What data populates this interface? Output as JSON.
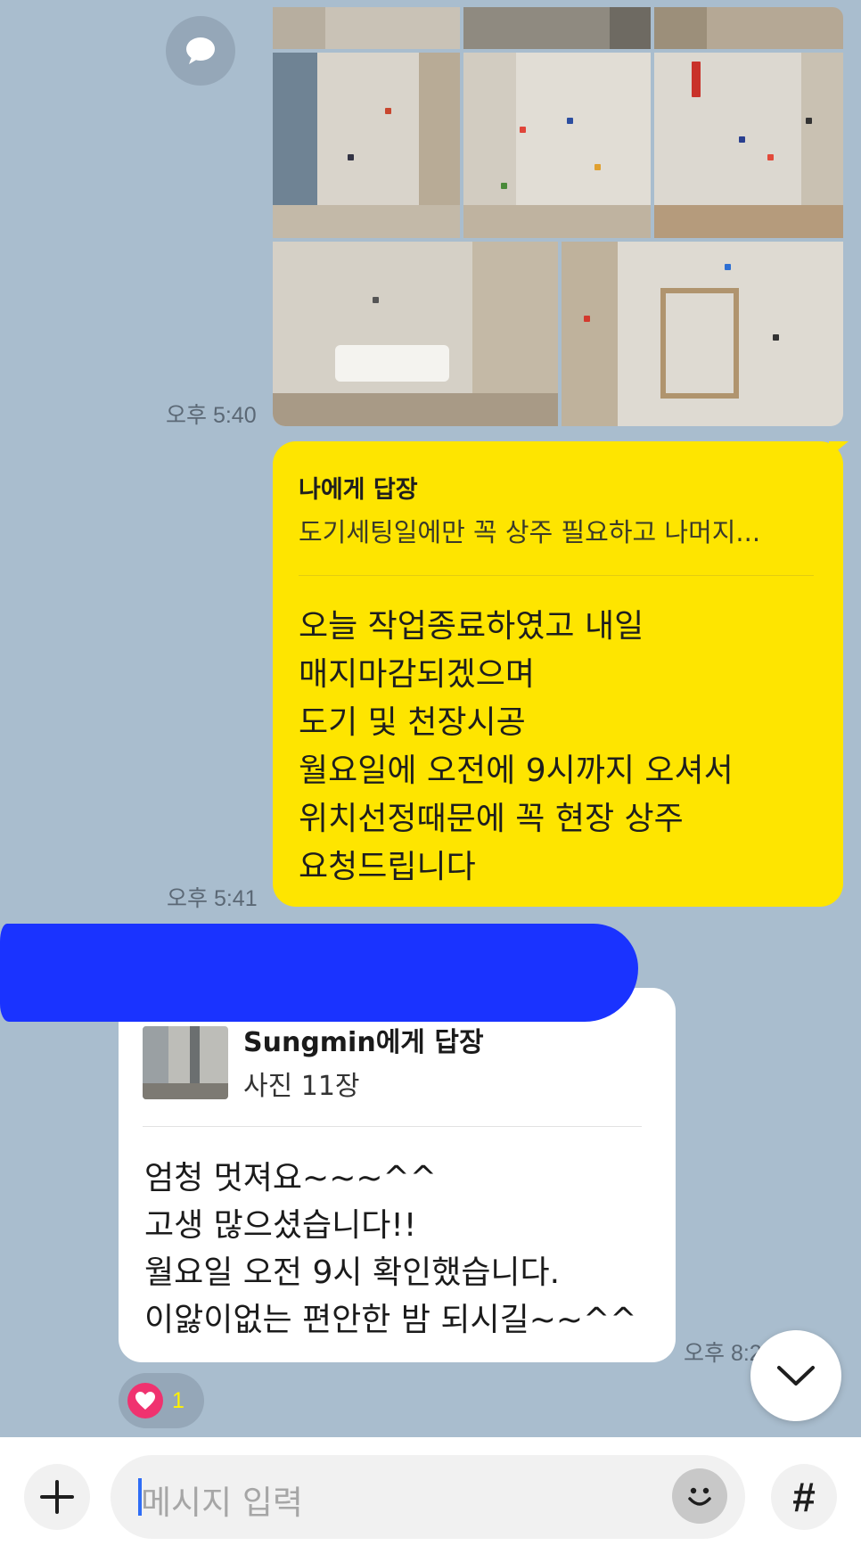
{
  "colors": {
    "background": "#a9bdce",
    "my_bubble": "#fee500",
    "other_bubble": "#ffffff",
    "redaction": "#1a33ff",
    "reaction_heart": "#f0326f"
  },
  "icons": {
    "share": "chat-bubble-icon",
    "heart": "heart-icon",
    "scroll_down": "chevron-down-icon",
    "plus": "plus-icon",
    "emoji": "smiley-icon",
    "hashtag": "hashtag-icon"
  },
  "messages": [
    {
      "sender": "me",
      "type": "photo-album",
      "time": "오후 5:40"
    },
    {
      "sender": "me",
      "reply_to": {
        "title": "나에게 답장",
        "preview": "도기세팅일에만 꼭 상주 필요하고 나머지..."
      },
      "lines": [
        "오늘 작업종료하였고 내일",
        "매지마감되겠으며",
        "도기 및 천장시공",
        "월요일에 오전에 9시까지 오셔서",
        "위치선정때문에 꼭 현장 상주",
        "요청드립니다"
      ],
      "time": "오후 5:41"
    },
    {
      "sender": "other",
      "reply_to": {
        "title": "Sungmin에게 답장",
        "preview": "사진 11장"
      },
      "lines": [
        "엄청 멋져요~~~^^",
        "고생 많으셨습니다!!",
        "월요일 오전 9시 확인했습니다.",
        "이앓이없는 편안한 밤 되시길~~^^"
      ],
      "time": "오후 8:26",
      "reaction": {
        "count": "1"
      }
    }
  ],
  "input": {
    "placeholder": "메시지 입력"
  }
}
